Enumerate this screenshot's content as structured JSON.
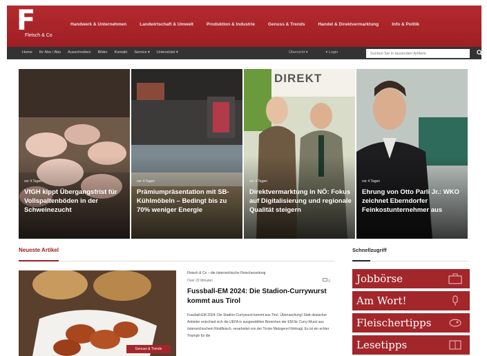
{
  "brand": {
    "logo_letter": "F",
    "logo_text": "Fleisch & Co"
  },
  "main_nav": [
    "Handwerk & Unternehmen",
    "Landwirtschaft & Umwelt",
    "Produktion & Industrie",
    "Genuss & Trends",
    "Handel & Direktvermarktung",
    "Info & Politik"
  ],
  "sub_nav": [
    "Home",
    "Ihr Abo / Abo",
    "Ausschreiben",
    "Bilder",
    "Kontakt",
    "Service ▾",
    "Unterstützt ▾"
  ],
  "login": {
    "register": "Übersicht ▾",
    "login": "▾ Login"
  },
  "search": {
    "placeholder": "Suchen Sie in tausenden Artikeln"
  },
  "hero": [
    {
      "meta": "vor 4 Tagen",
      "title": "VfGH kippt Übergangsfrist für Vollspaltenböden in der Schweinezucht"
    },
    {
      "meta": "vor 4 Tagen",
      "title": "Prämiumpräsentation mit SB-Kühlmöbeln – Bedingt bis zu 70% weniger Energie"
    },
    {
      "meta": "vor 4 Tagen",
      "title": "Direktvermarktung in NÖ: Fokus auf Digitalisierung und regionale Qualität steigern"
    },
    {
      "meta": "vor 4 Tagen",
      "title": "Ehrung von Otto Parli Jr.: WKO zeichnet Eberndorfer Feinkostunternehmer aus"
    }
  ],
  "hero_sign": "DIREKT",
  "section_title": "Neueste Artikel",
  "sidebar_title": "Schnellzugriff",
  "article": {
    "source": "Fleisch & Co – die österreichische Fleischerzeitung",
    "time": "Over 22 Minuten",
    "count": "0",
    "title": "Fussball-EM 2024: Die Stadion-Currywurst kommt aus Tirol",
    "body": "Fussball-EM 2024: Die Stadion-Currywurst kommt aus Tirol. Überraschung! Statt deutscher Anbieter entschied sich die UEFA in ausgewählten Bereichen der EM für Curry-Wurst aus österreichischem Rindfleisch, verarbeitet von der Tiroler Metzgerei Hörtnagl. Es ist ein echter Triumph für die",
    "badge": "Genuss & Trends"
  },
  "quick_links": [
    "Jobbörse",
    "Am Wort!",
    "Fleischertipps",
    "Lesetipps"
  ],
  "colors": {
    "brand_red": "#a3262b",
    "dark_bar": "#333333"
  }
}
